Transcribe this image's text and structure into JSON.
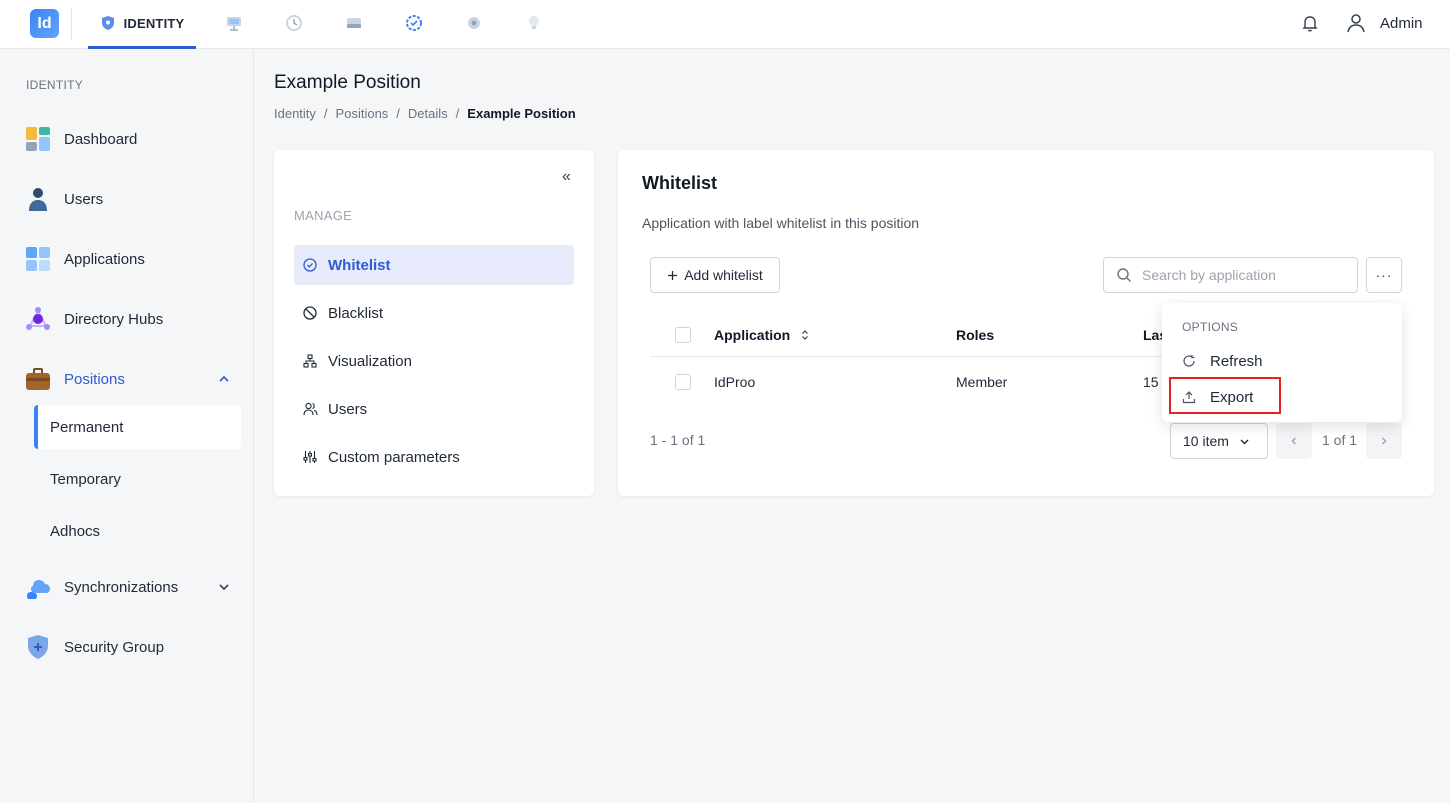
{
  "app": {
    "logo_text": "Id",
    "nav_identity_label": "IDENTITY",
    "user_name": "Admin",
    "brand_color": "#2f5bd3"
  },
  "icons": [
    "shield-icon",
    "monitor-icon",
    "history-icon",
    "server-icon",
    "check-circle-icon",
    "gear-icon",
    "lightbulb-icon",
    "bell-icon",
    "user-icon"
  ],
  "sidebar": {
    "section_title": "IDENTITY",
    "items": [
      {
        "label": "Dashboard"
      },
      {
        "label": "Users"
      },
      {
        "label": "Applications"
      },
      {
        "label": "Directory Hubs"
      },
      {
        "label": "Positions"
      },
      {
        "label": "Synchronizations"
      },
      {
        "label": "Security Group"
      }
    ],
    "positions_sub": [
      {
        "label": "Permanent"
      },
      {
        "label": "Temporary"
      },
      {
        "label": "Adhocs"
      }
    ]
  },
  "page": {
    "title": "Example Position",
    "breadcrumb": [
      "Identity",
      "Positions",
      "Details",
      "Example Position"
    ],
    "breadcrumb_sep": "/"
  },
  "manage": {
    "collapse_glyph": "«",
    "title": "MANAGE",
    "items": [
      {
        "label": "Whitelist"
      },
      {
        "label": "Blacklist"
      },
      {
        "label": "Visualization"
      },
      {
        "label": "Users"
      },
      {
        "label": "Custom parameters"
      }
    ]
  },
  "whitelist": {
    "title": "Whitelist",
    "description": "Application with label whitelist in this position",
    "add_button": "Add whitelist",
    "search_placeholder": "Search by application",
    "more_button": "···",
    "columns": [
      "Application",
      "Roles",
      "Las"
    ],
    "rows": [
      {
        "application": "IdProo",
        "roles": "Member",
        "last": "15"
      }
    ],
    "range_text": "1 - 1 of 1",
    "page_size": "10 item",
    "page_text": "1 of 1"
  },
  "options_menu": {
    "title": "OPTIONS",
    "items": [
      {
        "label": "Refresh"
      },
      {
        "label": "Export"
      }
    ]
  }
}
